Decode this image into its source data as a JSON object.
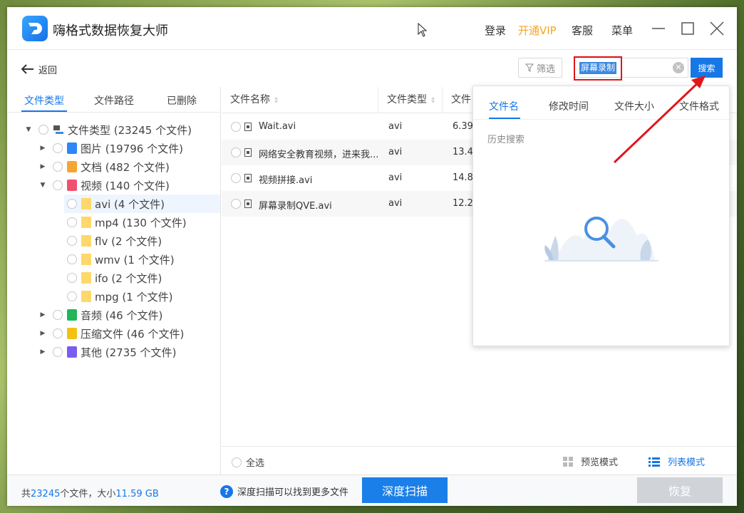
{
  "app": {
    "title": "嗨格式数据恢复大师",
    "login": "登录",
    "vip": "开通VIP",
    "service": "客服",
    "menu": "菜单"
  },
  "toolbar": {
    "back": "返回",
    "filter": "筛选",
    "search_value": "屏幕录制",
    "search_button": "搜索"
  },
  "left_tabs": [
    "文件类型",
    "文件路径",
    "已删除"
  ],
  "tree": {
    "root": "文件类型 (23245 个文件)",
    "items": [
      {
        "label": "图片 (19796 个文件)",
        "color": "#2f86f6"
      },
      {
        "label": "文档 (482 个文件)",
        "color": "#f6a531"
      },
      {
        "label": "视频 (140 个文件)",
        "color": "#f0506e"
      },
      {
        "label": "音频 (46 个文件)",
        "color": "#22b55a"
      },
      {
        "label": "压缩文件 (46 个文件)",
        "color": "#f4c012"
      },
      {
        "label": "其他 (2735 个文件)",
        "color": "#7b5cf0"
      }
    ],
    "video_children": [
      "avi (4 个文件)",
      "mp4 (130 个文件)",
      "flv (2 个文件)",
      "wmv (1 个文件)",
      "ifo (2 个文件)",
      "mpg (1 个文件)"
    ]
  },
  "columns": [
    "文件名称",
    "文件类型",
    "文件"
  ],
  "files": [
    {
      "name": "Wait.avi",
      "type": "avi",
      "size": "6.39"
    },
    {
      "name": "网络安全教育视频，进来我...",
      "type": "avi",
      "size": "13.4"
    },
    {
      "name": "视频拼接.avi",
      "type": "avi",
      "size": "14.8"
    },
    {
      "name": "屏幕录制QVE.avi",
      "type": "avi",
      "size": "12.2"
    }
  ],
  "list_footer": {
    "select_all": "全选",
    "preview_mode": "预览模式",
    "list_mode": "列表模式"
  },
  "status": {
    "prefix": "共",
    "count": "23245",
    "mid": "个文件，大小",
    "size": "11.59 GB",
    "hint": "深度扫描可以找到更多文件",
    "deep_scan": "深度扫描",
    "recover": "恢复"
  },
  "popup": {
    "tabs": [
      "文件名",
      "修改时间",
      "文件大小",
      "文件格式"
    ],
    "history": "历史搜索"
  },
  "colors": {
    "accent": "#1677e6",
    "vip": "#f4a623",
    "annotation": "#e0161b"
  }
}
